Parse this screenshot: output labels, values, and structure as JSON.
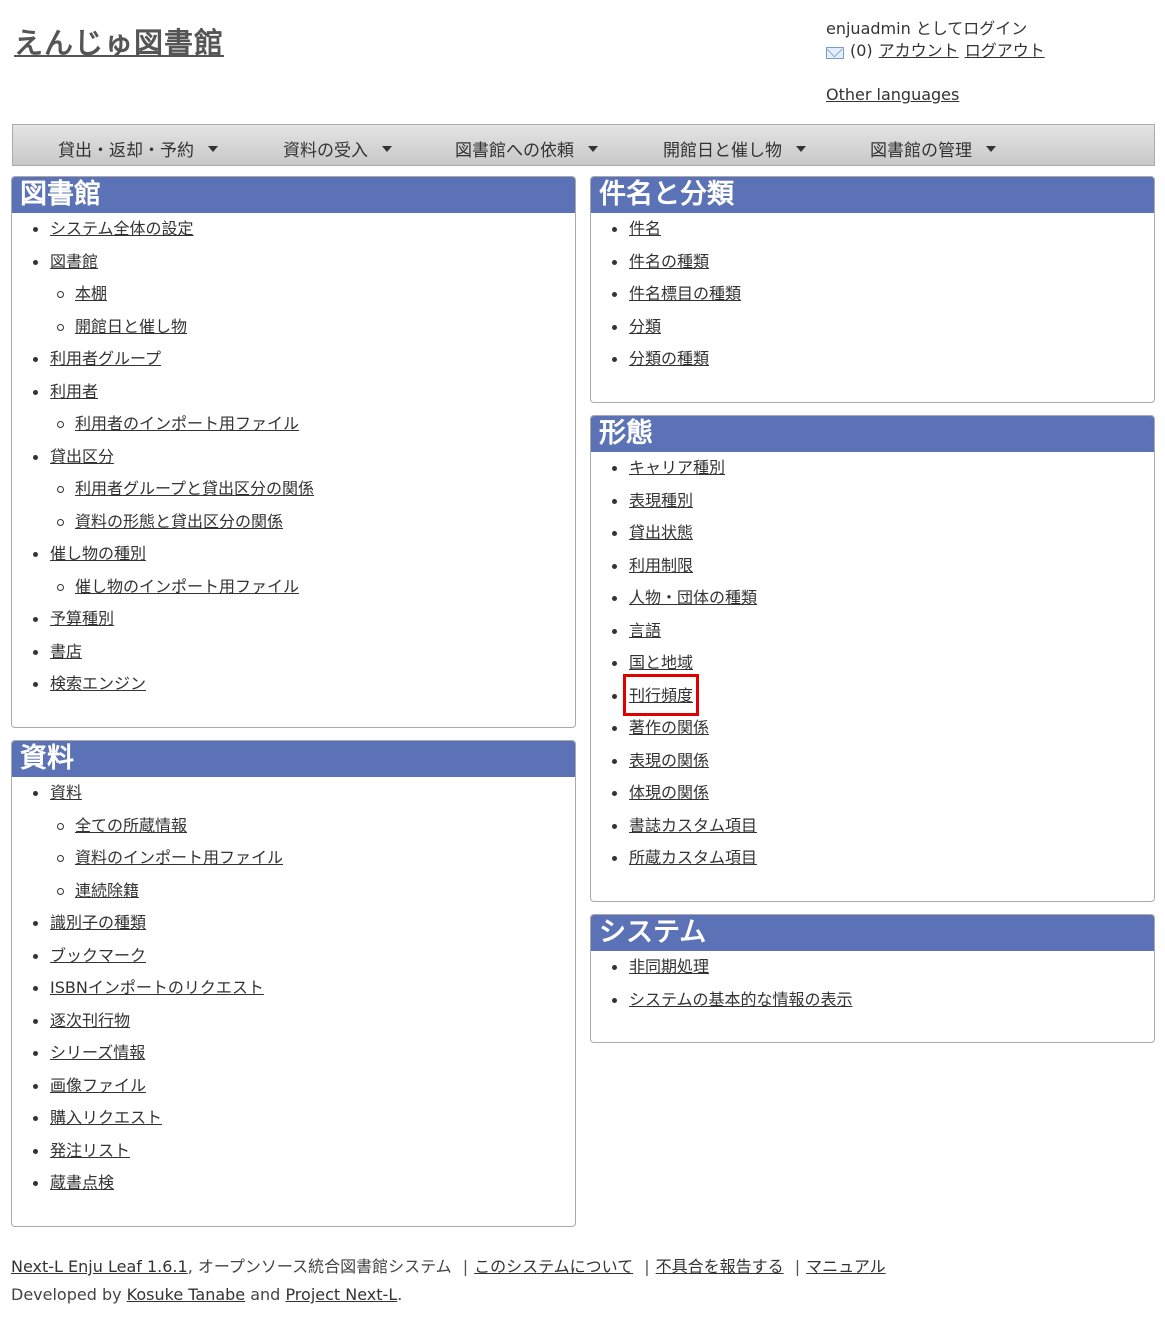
{
  "header": {
    "site_title": "えんじゅ図書館",
    "login_status": "enjuadmin としてログイン",
    "message_count": "(0)",
    "account_link": "アカウント",
    "logout_link": "ログアウト",
    "other_languages": "Other languages"
  },
  "nav": {
    "items": [
      {
        "label": "貸出・返却・予約"
      },
      {
        "label": "資料の受入"
      },
      {
        "label": "図書館への依頼"
      },
      {
        "label": "開館日と催し物"
      },
      {
        "label": "図書館の管理"
      }
    ]
  },
  "panels": {
    "library": {
      "title": "図書館",
      "items": [
        {
          "label": "システム全体の設定",
          "level": 1
        },
        {
          "label": "図書館",
          "level": 1
        },
        {
          "label": "本棚",
          "level": 2
        },
        {
          "label": "開館日と催し物",
          "level": 2
        },
        {
          "label": "利用者グループ",
          "level": 1
        },
        {
          "label": "利用者",
          "level": 1
        },
        {
          "label": "利用者のインポート用ファイル",
          "level": 2
        },
        {
          "label": "貸出区分",
          "level": 1
        },
        {
          "label": "利用者グループと貸出区分の関係",
          "level": 2
        },
        {
          "label": "資料の形態と貸出区分の関係",
          "level": 2
        },
        {
          "label": "催し物の種別",
          "level": 1
        },
        {
          "label": "催し物のインポート用ファイル",
          "level": 2
        },
        {
          "label": "予算種別",
          "level": 1
        },
        {
          "label": "書店",
          "level": 1
        },
        {
          "label": "検索エンジン",
          "level": 1
        }
      ]
    },
    "materials": {
      "title": "資料",
      "items": [
        {
          "label": "資料",
          "level": 1
        },
        {
          "label": "全ての所蔵情報",
          "level": 2
        },
        {
          "label": "資料のインポート用ファイル",
          "level": 2
        },
        {
          "label": "連続除籍",
          "level": 2
        },
        {
          "label": "識別子の種類",
          "level": 1
        },
        {
          "label": "ブックマーク",
          "level": 1
        },
        {
          "label": "ISBNインポートのリクエスト",
          "level": 1
        },
        {
          "label": "逐次刊行物",
          "level": 1
        },
        {
          "label": "シリーズ情報",
          "level": 1
        },
        {
          "label": "画像ファイル",
          "level": 1
        },
        {
          "label": "購入リクエスト",
          "level": 1
        },
        {
          "label": "発注リスト",
          "level": 1
        },
        {
          "label": "蔵書点検",
          "level": 1
        }
      ]
    },
    "subjects": {
      "title": "件名と分類",
      "items": [
        {
          "label": "件名",
          "level": 1
        },
        {
          "label": "件名の種類",
          "level": 1
        },
        {
          "label": "件名標目の種類",
          "level": 1
        },
        {
          "label": "分類",
          "level": 1
        },
        {
          "label": "分類の種類",
          "level": 1
        }
      ]
    },
    "forms": {
      "title": "形態",
      "items": [
        {
          "label": "キャリア種別",
          "level": 1
        },
        {
          "label": "表現種別",
          "level": 1
        },
        {
          "label": "貸出状態",
          "level": 1
        },
        {
          "label": "利用制限",
          "level": 1
        },
        {
          "label": "人物・団体の種類",
          "level": 1
        },
        {
          "label": "言語",
          "level": 1
        },
        {
          "label": "国と地域",
          "level": 1
        },
        {
          "label": "刊行頻度",
          "level": 1,
          "highlighted": true
        },
        {
          "label": "著作の関係",
          "level": 1
        },
        {
          "label": "表現の関係",
          "level": 1
        },
        {
          "label": "体現の関係",
          "level": 1
        },
        {
          "label": "書誌カスタム項目",
          "level": 1
        },
        {
          "label": "所蔵カスタム項目",
          "level": 1
        }
      ]
    },
    "system": {
      "title": "システム",
      "items": [
        {
          "label": "非同期処理",
          "level": 1
        },
        {
          "label": "システムの基本的な情報の表示",
          "level": 1
        }
      ]
    }
  },
  "footer": {
    "product_link": "Next-L Enju Leaf 1.6.1",
    "description": ", オープンソース統合図書館システム",
    "about_link": "このシステムについて",
    "report_link": "不具合を報告する",
    "manual_link": "マニュアル",
    "developed_by": "Developed by",
    "author_link": "Kosuke Tanabe",
    "and_text": "and",
    "project_link": "Project Next-L",
    "period": "."
  },
  "colors": {
    "panel_header": "#5b73b6",
    "highlight": "#e00000"
  }
}
